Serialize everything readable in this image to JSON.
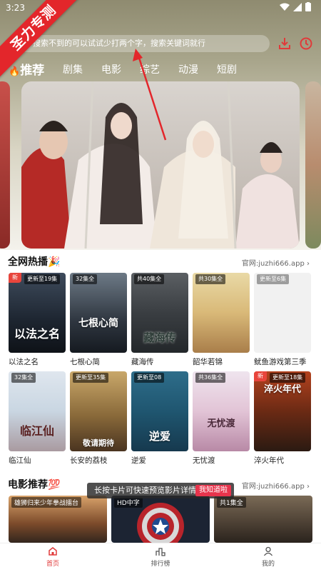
{
  "status_bar": {
    "time": "3:23"
  },
  "ribbon": {
    "text": "圣力专测"
  },
  "search": {
    "placeholder": "搜索不到的可以试试少打两个字，搜索关键词就行"
  },
  "tabs": [
    {
      "label": "推荐",
      "active": true
    },
    {
      "label": "剧集"
    },
    {
      "label": "电影"
    },
    {
      "label": "综艺"
    },
    {
      "label": "动漫"
    },
    {
      "label": "短剧"
    }
  ],
  "hot_section": {
    "title": "全网热播",
    "emoji": "🎉",
    "more": "官网:juzhi666.app"
  },
  "hot_items": [
    {
      "badge": "更新至19集",
      "new": true,
      "title": "以法之名",
      "poster_text": "以法之名"
    },
    {
      "badge": "32集全",
      "title": "七根心简",
      "poster_text": "七根心简"
    },
    {
      "badge": "共40集全",
      "title": "藏海传",
      "poster_text": "藏海传"
    },
    {
      "badge": "共30集全",
      "title": "韶华若锦",
      "poster_text": ""
    },
    {
      "badge": "更新至6集",
      "title": "鱿鱼游戏第三季",
      "poster_text": ""
    },
    {
      "badge": "32集全",
      "title": "临江仙",
      "poster_text": "临江仙"
    },
    {
      "badge": "更新至35集",
      "title": "长安的荔枝",
      "poster_text": "敬请期待"
    },
    {
      "badge": "更新至08",
      "title": "逆爱",
      "poster_text": "逆爱"
    },
    {
      "badge": "共36集全",
      "title": "无忧渡",
      "poster_text": "无忧渡"
    },
    {
      "badge": "更新至18集",
      "new": true,
      "title": "淬火年代",
      "poster_text": "淬火年代"
    }
  ],
  "movie_section": {
    "title": "电影推荐",
    "emoji": "💯",
    "more": "官网:juzhi666.app"
  },
  "movie_items": [
    {
      "badge": "雄狮归来少年拳战擂台"
    },
    {
      "badge": "HD中字"
    },
    {
      "badge": "共1集全"
    }
  ],
  "toast": {
    "text": "长按卡片可快速预览影片详情",
    "button": "我知道啦"
  },
  "bottom_nav": [
    {
      "label": "首页",
      "active": true
    },
    {
      "label": "排行榜"
    },
    {
      "label": "我的"
    }
  ],
  "colors": {
    "accent": "#e03a3a",
    "ribbon": "#e3262b",
    "header_top": "#8f8b70"
  },
  "icons": [
    "download-icon",
    "history-icon",
    "fire-icon",
    "home-icon",
    "ranking-icon",
    "profile-icon"
  ]
}
